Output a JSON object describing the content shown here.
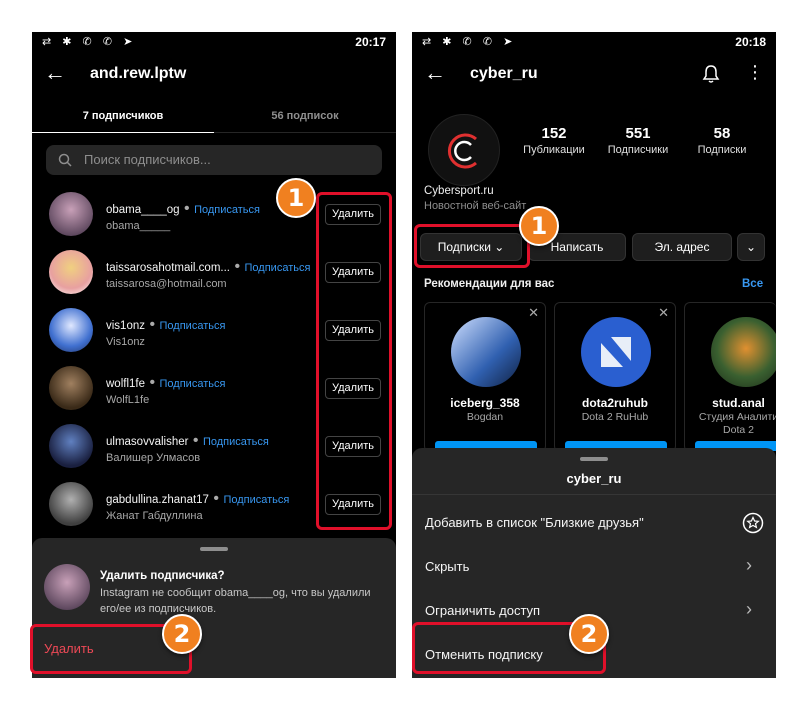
{
  "left": {
    "status": {
      "icons": "⇄ ✱ ✆ ✆ ➤",
      "time": "20:17"
    },
    "title": "and.rew.lptw",
    "tabs": [
      "7 подписчиков",
      "56 подписок"
    ],
    "search_placeholder": "Поиск подписчиков...",
    "followers": [
      {
        "username": "obama____og",
        "follow": "Подписаться",
        "name": "obama_____",
        "remove": "Удалить"
      },
      {
        "username": "taissarosahotmail.com...",
        "follow": "Подписаться",
        "name": "taissarosa@hotmail.com",
        "remove": "Удалить"
      },
      {
        "username": "vis1onz",
        "follow": "Подписаться",
        "name": "Vis1onz",
        "remove": "Удалить"
      },
      {
        "username": "wolfl1fe",
        "follow": "Подписаться",
        "name": "WolfL1fe",
        "remove": "Удалить"
      },
      {
        "username": "ulmasovvalisher",
        "follow": "Подписаться",
        "name": "Валишер Улмасов",
        "remove": "Удалить"
      },
      {
        "username": "gabdullina.zhanat17",
        "follow": "Подписаться",
        "name": "Жанат Габдуллина",
        "remove": "Удалить"
      }
    ],
    "sheet": {
      "title": "Удалить подписчика?",
      "body": "Instagram не сообщит obama____og, что вы удалили его/ее из подписчиков.",
      "action": "Удалить"
    }
  },
  "right": {
    "status": {
      "icons": "⇄ ✱ ✆ ✆ ➤",
      "time": "20:18"
    },
    "title": "cyber_ru",
    "stats": [
      {
        "value": "152",
        "label": "Публикации"
      },
      {
        "value": "551",
        "label": "Подписчики"
      },
      {
        "value": "58",
        "label": "Подписки"
      }
    ],
    "profile_name": "Cybersport.ru",
    "profile_category": "Новостной веб-сайт",
    "buttons": {
      "following": "Подписки ⌄",
      "message": "Написать",
      "email": "Эл. адрес",
      "more": "⌄"
    },
    "recommendations": {
      "title": "Рекомендации для вас",
      "all": "Все"
    },
    "cards": [
      {
        "name": "iceberg_358",
        "sub": "Bogdan"
      },
      {
        "name": "dota2ruhub",
        "sub": "Dota 2 RuHub"
      },
      {
        "name": "stud.anal",
        "sub": "Студия Аналити Dota 2"
      }
    ],
    "sheet": {
      "title": "cyber_ru",
      "items": [
        "Добавить в список \"Близкие друзья\"",
        "Скрыть",
        "Ограничить доступ",
        "Отменить подписку"
      ]
    }
  },
  "badges": {
    "one": "1",
    "two": "2"
  },
  "colors": {
    "highlight": "#e0102a",
    "badge": "#f08020",
    "link": "#3897f0",
    "delete": "#ed4956"
  }
}
